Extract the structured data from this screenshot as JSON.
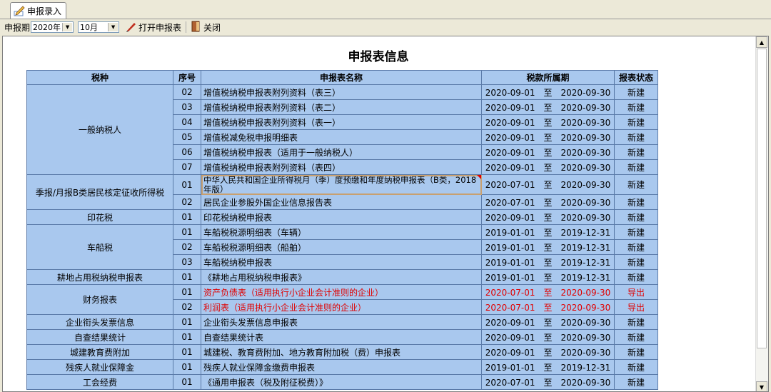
{
  "tab": {
    "label": "申报录入"
  },
  "toolbar": {
    "period_label": "申报期",
    "year": "2020年",
    "month": "10月",
    "open_label": "打开申报表",
    "close_label": "关闭"
  },
  "page": {
    "title": "申报表信息"
  },
  "table": {
    "headers": [
      "税种",
      "序号",
      "申报表名称",
      "税款所属期",
      "报表状态"
    ],
    "period_sep": "至",
    "groups": [
      {
        "tax": "一般纳税人",
        "rows": [
          {
            "seq": "02",
            "name": "增值税纳税申报表附列资料（表三）",
            "from": "2020-09-01",
            "to": "2020-09-30",
            "status": "新建"
          },
          {
            "seq": "03",
            "name": "增值税纳税申报表附列资料（表二）",
            "from": "2020-09-01",
            "to": "2020-09-30",
            "status": "新建"
          },
          {
            "seq": "04",
            "name": "增值税纳税申报表附列资料（表一）",
            "from": "2020-09-01",
            "to": "2020-09-30",
            "status": "新建"
          },
          {
            "seq": "05",
            "name": "增值税减免税申报明细表",
            "from": "2020-09-01",
            "to": "2020-09-30",
            "status": "新建"
          },
          {
            "seq": "06",
            "name": "增值税纳税申报表（适用于一般纳税人）",
            "from": "2020-09-01",
            "to": "2020-09-30",
            "status": "新建"
          },
          {
            "seq": "07",
            "name": "增值税纳税申报表附列资料（表四）",
            "from": "2020-09-01",
            "to": "2020-09-30",
            "status": "新建"
          }
        ]
      },
      {
        "tax": "季报/月报B类居民核定征收所得税",
        "rows": [
          {
            "seq": "01",
            "name": "中华人民共和国企业所得税月（季）度预缴和年度纳税申报表（B类，2018年版）",
            "from": "2020-07-01",
            "to": "2020-09-30",
            "status": "新建",
            "selected": true
          },
          {
            "seq": "02",
            "name": "居民企业参股外国企业信息报告表",
            "from": "2020-07-01",
            "to": "2020-09-30",
            "status": "新建"
          }
        ]
      },
      {
        "tax": "印花税",
        "rows": [
          {
            "seq": "01",
            "name": "印花税纳税申报表",
            "from": "2020-09-01",
            "to": "2020-09-30",
            "status": "新建"
          }
        ]
      },
      {
        "tax": "车船税",
        "rows": [
          {
            "seq": "01",
            "name": "车船税税源明细表（车辆）",
            "from": "2019-01-01",
            "to": "2019-12-31",
            "status": "新建"
          },
          {
            "seq": "02",
            "name": "车船税税源明细表（船舶）",
            "from": "2019-01-01",
            "to": "2019-12-31",
            "status": "新建"
          },
          {
            "seq": "03",
            "name": "车船税纳税申报表",
            "from": "2019-01-01",
            "to": "2019-12-31",
            "status": "新建"
          }
        ]
      },
      {
        "tax": "耕地占用税纳税申报表",
        "rows": [
          {
            "seq": "01",
            "name": "《耕地占用税纳税申报表》",
            "from": "2019-01-01",
            "to": "2019-12-31",
            "status": "新建"
          }
        ]
      },
      {
        "tax": "财务报表",
        "rows": [
          {
            "seq": "01",
            "name": "资产负债表（适用执行小企业会计准则的企业）",
            "from": "2020-07-01",
            "to": "2020-09-30",
            "status": "导出",
            "red": true
          },
          {
            "seq": "02",
            "name": "利润表（适用执行小企业会计准则的企业）",
            "from": "2020-07-01",
            "to": "2020-09-30",
            "status": "导出",
            "red": true
          }
        ]
      },
      {
        "tax": "企业衔头发票信息",
        "rows": [
          {
            "seq": "01",
            "name": "企业衔头发票信息申报表",
            "from": "2020-09-01",
            "to": "2020-09-30",
            "status": "新建"
          }
        ]
      },
      {
        "tax": "自查结果统计",
        "rows": [
          {
            "seq": "01",
            "name": "自查结果统计表",
            "from": "2020-09-01",
            "to": "2020-09-30",
            "status": "新建"
          }
        ]
      },
      {
        "tax": "城建教育费附加",
        "rows": [
          {
            "seq": "01",
            "name": "城建税、教育费附加、地方教育附加税（费）申报表",
            "from": "2020-09-01",
            "to": "2020-09-30",
            "status": "新建"
          }
        ]
      },
      {
        "tax": "残疾人就业保障金",
        "rows": [
          {
            "seq": "01",
            "name": "残疾人就业保障金缴费申报表",
            "from": "2019-01-01",
            "to": "2019-12-31",
            "status": "新建"
          }
        ]
      },
      {
        "tax": "工会经费",
        "rows": [
          {
            "seq": "01",
            "name": "《通用申报表（税及附征税费）》",
            "from": "2020-07-01",
            "to": "2020-09-30",
            "status": "新建"
          }
        ]
      }
    ]
  }
}
